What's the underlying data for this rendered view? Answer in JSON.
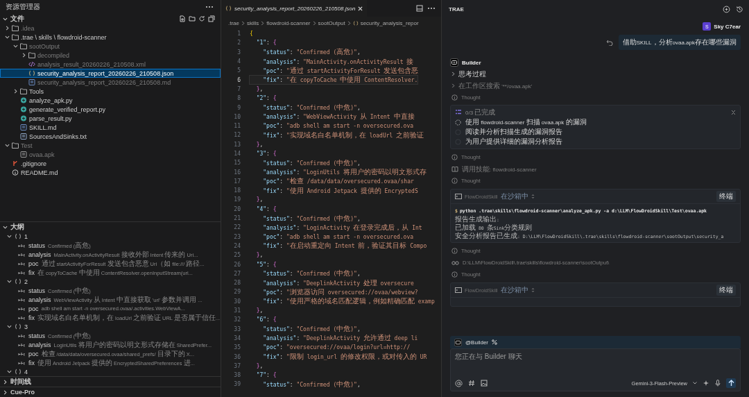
{
  "explorer": {
    "title": "资源管理器",
    "section": "文件",
    "tree": [
      {
        "name": ".idea",
        "kind": "folder",
        "expanded": false,
        "ignored": true,
        "selected": false
      },
      {
        "name": ".trae \\ skills \\ flowdroid-scanner",
        "kind": "folder",
        "expanded": true,
        "ignored": false,
        "selected": false,
        "children": [
          {
            "name": "sootOutput",
            "kind": "folder",
            "expanded": true,
            "ignored": true,
            "selected": false,
            "children": [
              {
                "name": "decompiled",
                "kind": "folder",
                "expanded": false,
                "ignored": true,
                "selected": false
              },
              {
                "name": "analysis_result_20260226_210508.xml",
                "kind": "xml",
                "ignored": true,
                "selected": false
              },
              {
                "name": "security_analysis_report_20260226_210508.json",
                "kind": "json",
                "ignored": false,
                "selected": true
              },
              {
                "name": "security_analysis_report_20260226_210508.md",
                "kind": "md",
                "ignored": true,
                "selected": false
              }
            ]
          },
          {
            "name": "Tools",
            "kind": "folder",
            "expanded": false,
            "ignored": false,
            "selected": false
          },
          {
            "name": "analyze_apk.py",
            "kind": "py",
            "ignored": false,
            "selected": false
          },
          {
            "name": "generate_verified_report.py",
            "kind": "py",
            "ignored": false,
            "selected": false
          },
          {
            "name": "parse_result.py",
            "kind": "py",
            "ignored": false,
            "selected": false
          },
          {
            "name": "SKILL.md",
            "kind": "md",
            "ignored": false,
            "selected": false
          },
          {
            "name": "SourcesAndSinks.txt",
            "kind": "txt",
            "ignored": false,
            "selected": false
          }
        ]
      },
      {
        "name": "Test",
        "kind": "folder",
        "expanded": true,
        "ignored": true,
        "selected": false,
        "children": [
          {
            "name": "ovaa.apk",
            "kind": "file",
            "ignored": true,
            "selected": false
          }
        ]
      },
      {
        "name": ".gitignore",
        "kind": "git",
        "ignored": false,
        "selected": false
      },
      {
        "name": "README.md",
        "kind": "info",
        "ignored": false,
        "selected": false
      }
    ]
  },
  "outline": {
    "title": "大纲",
    "groups": [
      {
        "label": "1",
        "expanded": true,
        "entries": [
          {
            "key": "status",
            "value": "Confirmed (高危)"
          },
          {
            "key": "analysis",
            "value": "MainActivity.onActivityResult 接收外部 Intent 传来的 Uri..."
          },
          {
            "key": "poc",
            "value": "通过 startActivityForResult 发送包含恶意 Uri（如 file:/// 路径..."
          },
          {
            "key": "fix",
            "value": "在 copyToCache 中使用 ContentResolver.openInputStream(uri..."
          }
        ]
      },
      {
        "label": "2",
        "expanded": true,
        "entries": [
          {
            "key": "status",
            "value": "Confirmed (中危)"
          },
          {
            "key": "analysis",
            "value": "WebViewActivity 从 Intent 中直接获取 'url' 参数并调用 ..."
          },
          {
            "key": "poc",
            "value": "adb shell am start -n oversecured.ovaa/.activities.WebViewA..."
          },
          {
            "key": "fix",
            "value": "实现域名白名单机制，在 loadUrl 之前验证 URL 是否属于信任..."
          }
        ]
      },
      {
        "label": "3",
        "expanded": true,
        "entries": [
          {
            "key": "status",
            "value": "Confirmed (中危)"
          },
          {
            "key": "analysis",
            "value": "LoginUtils 将用户的密码以明文形式存储在 SharedPrefer..."
          },
          {
            "key": "poc",
            "value": "检查 /data/data/oversecured.ovaa/shared_prefs/ 目录下的 X..."
          },
          {
            "key": "fix",
            "value": "使用 Android Jetpack 提供的 EncryptedSharedPreferences 进..."
          }
        ]
      },
      {
        "label": "4",
        "expanded": true
      }
    ]
  },
  "bottom_sections": [
    "时间线",
    "Cue-Pro"
  ],
  "editor": {
    "tab": {
      "label": "security_analysis_report_20260226_210508.json",
      "preview": true
    },
    "breadcrumb": [
      ".trae",
      "skills",
      "flowdroid-scanner",
      "sootOutput",
      "security_analysis_repor"
    ],
    "lines": [
      {
        "number": "1",
        "text": "{",
        "current": false
      },
      {
        "number": "2",
        "text": "  \"1\": {",
        "current": false
      },
      {
        "number": "3",
        "text": "    \"status\": \"Confirmed (高危)\",",
        "current": false
      },
      {
        "number": "4",
        "text": "    \"analysis\": \"MainActivity.onActivityResult 接",
        "current": false
      },
      {
        "number": "5",
        "text": "    \"poc\": \"通过 startActivityForResult 发送包含恶",
        "current": false
      },
      {
        "number": "6",
        "text": "    \"fix\": \"在 copyToCache 中使用 ContentResolver.",
        "current": true
      },
      {
        "number": "7",
        "text": "  },",
        "current": false
      },
      {
        "number": "8",
        "text": "  \"2\": {",
        "current": false
      },
      {
        "number": "9",
        "text": "    \"status\": \"Confirmed (中危)\",",
        "current": false
      },
      {
        "number": "10",
        "text": "    \"analysis\": \"WebViewActivity 从 Intent 中直接",
        "current": false
      },
      {
        "number": "11",
        "text": "    \"poc\": \"adb shell am start -n oversecured.ova",
        "current": false
      },
      {
        "number": "12",
        "text": "    \"fix\": \"实现域名白名单机制，在 loadUrl 之前验证",
        "current": false
      },
      {
        "number": "13",
        "text": "  },",
        "current": false
      },
      {
        "number": "14",
        "text": "  \"3\": {",
        "current": false
      },
      {
        "number": "15",
        "text": "    \"status\": \"Confirmed (中危)\",",
        "current": false
      },
      {
        "number": "16",
        "text": "    \"analysis\": \"LoginUtils 将用户的密码以明文形式存",
        "current": false
      },
      {
        "number": "17",
        "text": "    \"poc\": \"检查 /data/data/oversecured.ovaa/shar",
        "current": false
      },
      {
        "number": "18",
        "text": "    \"fix\": \"使用 Android Jetpack 提供的 EncryptedS",
        "current": false
      },
      {
        "number": "19",
        "text": "  },",
        "current": false
      },
      {
        "number": "20",
        "text": "  \"4\": {",
        "current": false
      },
      {
        "number": "21",
        "text": "    \"status\": \"Confirmed (中危)\",",
        "current": false
      },
      {
        "number": "22",
        "text": "    \"analysis\": \"LoginActivity 在登录完成后，从 Int",
        "current": false
      },
      {
        "number": "23",
        "text": "    \"poc\": \"adb shell am start -n oversecured.ova",
        "current": false
      },
      {
        "number": "24",
        "text": "    \"fix\": \"在启动重定向 Intent 前，验证其目标 Compo",
        "current": false
      },
      {
        "number": "25",
        "text": "  },",
        "current": false
      },
      {
        "number": "26",
        "text": "  \"5\": {",
        "current": false
      },
      {
        "number": "27",
        "text": "    \"status\": \"Confirmed (中危)\",",
        "current": false
      },
      {
        "number": "28",
        "text": "    \"analysis\": \"DeeplinkActivity 处理 oversecure",
        "current": false
      },
      {
        "number": "29",
        "text": "    \"poc\": \"浏览器访问 oversecured://ovaa/webview?",
        "current": false
      },
      {
        "number": "30",
        "text": "    \"fix\": \"使用严格的域名匹配逻辑，例如精确匹配 examp",
        "current": false
      },
      {
        "number": "31",
        "text": "  },",
        "current": false
      },
      {
        "number": "32",
        "text": "  \"6\": {",
        "current": false
      },
      {
        "number": "33",
        "text": "    \"status\": \"Confirmed (中危)\",",
        "current": false
      },
      {
        "number": "34",
        "text": "    \"analysis\": \"DeeplinkActivity 允许通过 deep li",
        "current": false
      },
      {
        "number": "35",
        "text": "    \"poc\": \"oversecured://ovaa/login?url=http://",
        "current": false
      },
      {
        "number": "36",
        "text": "    \"fix\": \"限制 login_url 的修改权限，或对传入的 UR",
        "current": false
      },
      {
        "number": "37",
        "text": "  },",
        "current": false
      },
      {
        "number": "38",
        "text": "  \"7\": {",
        "current": false
      },
      {
        "number": "39",
        "text": "    \"status\": \"Confirmed (中危)\",",
        "current": false
      }
    ]
  },
  "chat": {
    "title": "TRAE",
    "user": {
      "avatar": "S",
      "name": "Sky C7ear",
      "message": "借助SKILL，分析ovaa.apk存在哪些漏洞"
    },
    "agent": {
      "name": "Builder"
    },
    "steps": [
      {
        "kind": "toggle",
        "text": "思考过程"
      },
      {
        "kind": "search",
        "text": "在工作区搜索 '**/ovaa.apk'"
      },
      {
        "kind": "thought",
        "text": "Thought"
      },
      {
        "kind": "todo",
        "progress": "0/3 已完成",
        "items": [
          {
            "text": "使用 flowdroid-scanner 扫描 ovaa.apk 的漏洞",
            "active": true
          },
          {
            "text": "阅读并分析扫描生成的漏洞报告",
            "active": false
          },
          {
            "text": "为用户提供详细的漏洞分析报告",
            "active": false
          }
        ]
      },
      {
        "kind": "thought",
        "text": "Thought"
      },
      {
        "kind": "skill",
        "text": "调用技能: flowdroid-scanner"
      },
      {
        "kind": "thought",
        "text": "Thought"
      },
      {
        "kind": "terminal",
        "project": "FlowDroidSkill",
        "sandbox": "在沙箱中",
        "button": "终端",
        "prompt": "$",
        "command": "python .trae\\skills\\flowdroid-scanner\\analyze_apk.py -a d:\\LLM\\FlowDroidSkill\\Test\\ovaa.apk",
        "output": [
          "报告生成输出:",
          "已加载 80 条Sink分类规则",
          "安全分析报告已生成: D:\\LLM\\FlowDroidSkill\\.trae\\skills\\flowdroid-scanner\\sootOutput\\security_a"
        ]
      },
      {
        "kind": "thought",
        "text": "Thought"
      },
      {
        "kind": "read",
        "text": "D:\\LLM\\FlowDroidSkill\\.trae\\skills\\flowdroid-scanner\\sootOutput\\"
      },
      {
        "kind": "thought",
        "text": "Thought"
      },
      {
        "kind": "terminal",
        "project": "FlowDroidSkill",
        "sandbox": "在沙箱中",
        "button": "终端"
      }
    ],
    "composer": {
      "agent": "@Builder",
      "placeholder": "您正在与 Builder 聊天",
      "model": "Gemini-3-Flash-Preview"
    }
  }
}
